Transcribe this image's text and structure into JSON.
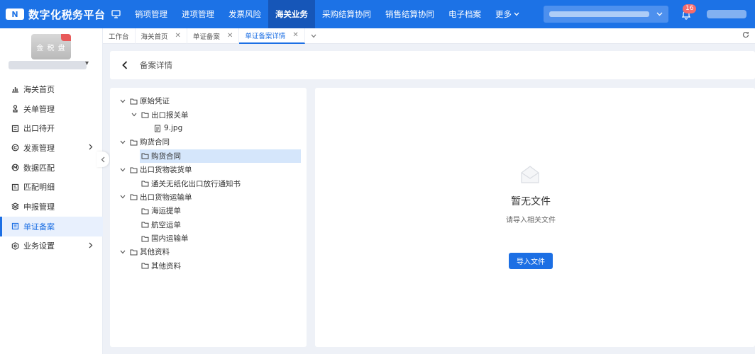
{
  "app": {
    "logo_mark": "N",
    "title": "数字化税务平台"
  },
  "topnav": {
    "items": [
      {
        "label": "销项管理"
      },
      {
        "label": "进项管理"
      },
      {
        "label": "发票风险"
      },
      {
        "label": "海关业务",
        "active": true
      },
      {
        "label": "采购结算协同"
      },
      {
        "label": "销售结算协同"
      },
      {
        "label": "电子档案"
      }
    ],
    "more_label": "更多",
    "notification_count": "16"
  },
  "sidebar": {
    "company_logo_text": "金 税 盘",
    "items": [
      {
        "label": "海关首页",
        "icon": "bar-chart-icon"
      },
      {
        "label": "关单管理",
        "icon": "stamp-icon"
      },
      {
        "label": "出口待开",
        "icon": "receipt-icon"
      },
      {
        "label": "发票管理",
        "icon": "invoice-icon",
        "expandable": true
      },
      {
        "label": "数据匹配",
        "icon": "match-icon"
      },
      {
        "label": "匹配明细",
        "icon": "detail-icon"
      },
      {
        "label": "申报管理",
        "icon": "layers-icon"
      },
      {
        "label": "单证备案",
        "icon": "document-icon",
        "active": true
      },
      {
        "label": "业务设置",
        "icon": "settings-icon",
        "expandable": true
      }
    ]
  },
  "tabs": [
    {
      "label": "工作台",
      "closable": false
    },
    {
      "label": "海关首页",
      "closable": true
    },
    {
      "label": "单证备案",
      "closable": true
    },
    {
      "label": "单证备案详情",
      "closable": true,
      "active": true
    }
  ],
  "detail": {
    "title": "备案详情"
  },
  "tree": [
    {
      "label": "原始凭证",
      "level": 0,
      "expanded": true
    },
    {
      "label": "出口报关单",
      "level": 1,
      "expanded": true
    },
    {
      "label": "9.jpg",
      "level": 2,
      "file": true
    },
    {
      "label": "购货合同",
      "level": 0,
      "expanded": true
    },
    {
      "label": "购货合同",
      "level": 1,
      "selected": true
    },
    {
      "label": "出口货物装货单",
      "level": 0,
      "expanded": true
    },
    {
      "label": "通关无纸化出口放行通知书",
      "level": 1
    },
    {
      "label": "出口货物运输单",
      "level": 0,
      "expanded": true
    },
    {
      "label": "海运提单",
      "level": 1
    },
    {
      "label": "航空运单",
      "level": 1
    },
    {
      "label": "国内运输单",
      "level": 1
    },
    {
      "label": "其他资料",
      "level": 0,
      "expanded": true
    },
    {
      "label": "其他资料",
      "level": 1
    }
  ],
  "empty_state": {
    "title": "暂无文件",
    "subtitle": "请导入相关文件",
    "button_label": "导入文件"
  },
  "colors": {
    "primary": "#1c72e6",
    "nav_active": "#1656b8",
    "badge": "#f56c6c",
    "selected_row": "#d5e6fb"
  }
}
